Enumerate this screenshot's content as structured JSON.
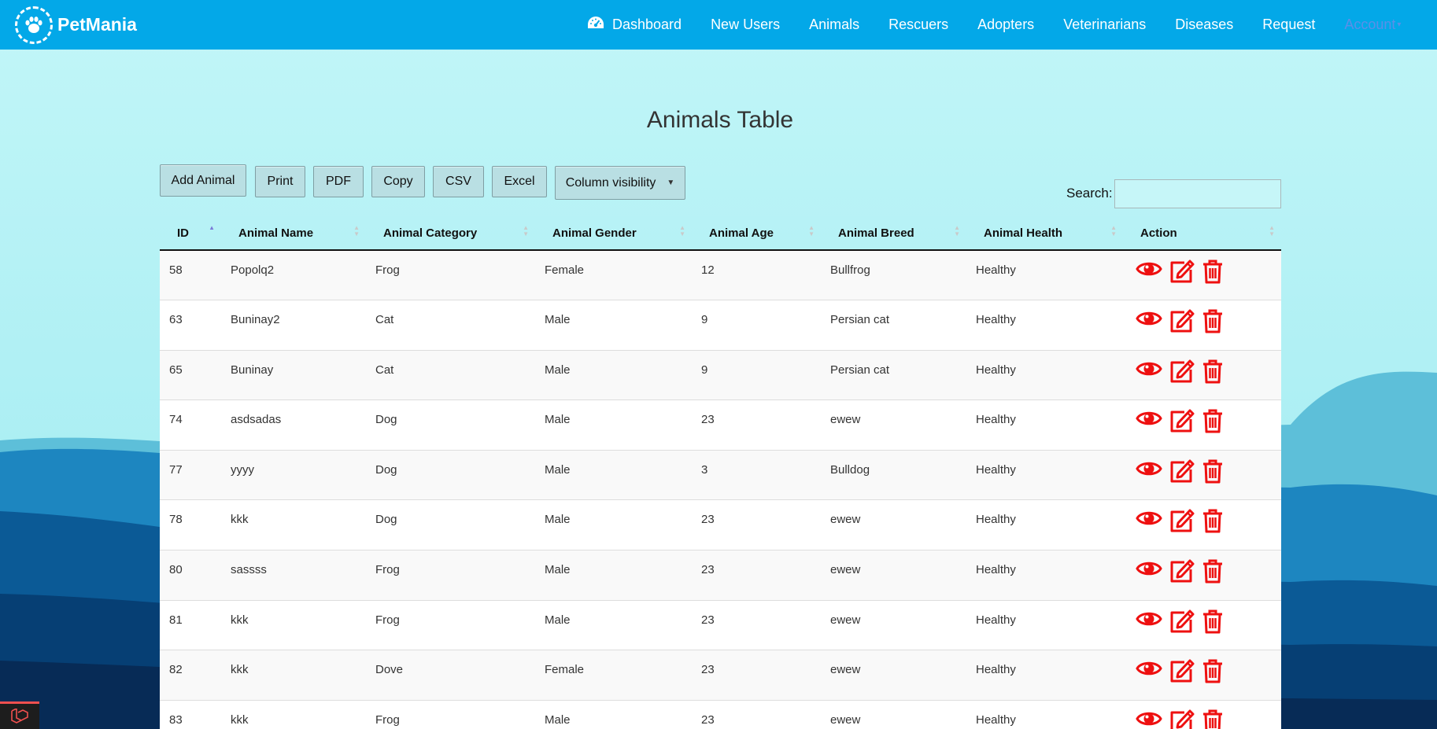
{
  "brand": {
    "name": "PetMania",
    "logo_icon": "paw-icon"
  },
  "nav": {
    "items": [
      {
        "label": "Dashboard",
        "icon": "gauge-icon"
      },
      {
        "label": "New Users"
      },
      {
        "label": "Animals"
      },
      {
        "label": "Rescuers"
      },
      {
        "label": "Adopters"
      },
      {
        "label": "Veterinarians"
      },
      {
        "label": "Diseases"
      },
      {
        "label": "Request"
      },
      {
        "label": "Account"
      }
    ]
  },
  "page": {
    "title": "Animals Table"
  },
  "toolbar": {
    "add_label": "Add Animal",
    "print_label": "Print",
    "pdf_label": "PDF",
    "copy_label": "Copy",
    "csv_label": "CSV",
    "excel_label": "Excel",
    "colvis_label": "Column visibility",
    "colvis_caret": "▼"
  },
  "search": {
    "label": "Search:",
    "value": "",
    "placeholder": ""
  },
  "table": {
    "columns": [
      "ID",
      "Animal Name",
      "Animal Category",
      "Animal Gender",
      "Animal Age",
      "Animal Breed",
      "Animal Health",
      "Action"
    ],
    "sorted_column": "ID",
    "sort_direction": "ascending",
    "rows": [
      [
        "58",
        "Popolq2",
        "Frog",
        "Female",
        "12",
        "Bullfrog",
        "Healthy"
      ],
      [
        "63",
        "Buninay2",
        "Cat",
        "Male",
        "9",
        "Persian cat",
        "Healthy"
      ],
      [
        "65",
        "Buninay",
        "Cat",
        "Male",
        "9",
        "Persian cat",
        "Healthy"
      ],
      [
        "74",
        "asdsadas",
        "Dog",
        "Male",
        "23",
        "ewew",
        "Healthy"
      ],
      [
        "77",
        "yyyy",
        "Dog",
        "Male",
        "3",
        "Bulldog",
        "Healthy"
      ],
      [
        "78",
        "kkk",
        "Dog",
        "Male",
        "23",
        "ewew",
        "Healthy"
      ],
      [
        "80",
        "sassss",
        "Frog",
        "Male",
        "23",
        "ewew",
        "Healthy"
      ],
      [
        "81",
        "kkk",
        "Frog",
        "Male",
        "23",
        "ewew",
        "Healthy"
      ],
      [
        "82",
        "kkk",
        "Dove",
        "Female",
        "23",
        "ewew",
        "Healthy"
      ],
      [
        "83",
        "kkk",
        "Frog",
        "Male",
        "23",
        "ewew",
        "Healthy"
      ]
    ],
    "row_action_icons": [
      "eye-icon",
      "edit-icon",
      "trash-icon"
    ]
  },
  "colors": {
    "navbar": "#03a8e8",
    "page_bg": "#c2f5f7",
    "action_icon": "#ee1010",
    "account_link": "#5b8fe8"
  }
}
